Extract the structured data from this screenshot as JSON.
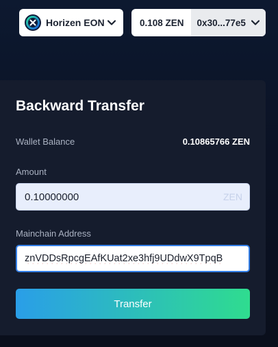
{
  "header": {
    "network": {
      "name": "Horizen EON",
      "icon": "horizen-logo-icon",
      "chevron": "chevron-down-icon"
    },
    "account": {
      "balance": "0.108 ZEN",
      "address": "0x30...77e5",
      "chevron": "chevron-down-icon"
    }
  },
  "form": {
    "title": "Backward Transfer",
    "wallet_balance_label": "Wallet Balance",
    "wallet_balance_value": "0.10865766 ZEN",
    "amount_label": "Amount",
    "amount_value": "0.10000000",
    "amount_unit": "ZEN",
    "address_label": "Mainchain Address",
    "address_value": "znVDDsRpcgEAfKUat2xe3hfj9UDdwX9TpqB",
    "submit_label": "Transfer"
  },
  "colors": {
    "background": "#0b1224",
    "card": "#151c2d",
    "accent_blue": "#2a9ee8",
    "accent_green": "#2fdc8f",
    "focus_border": "#3580e8"
  }
}
